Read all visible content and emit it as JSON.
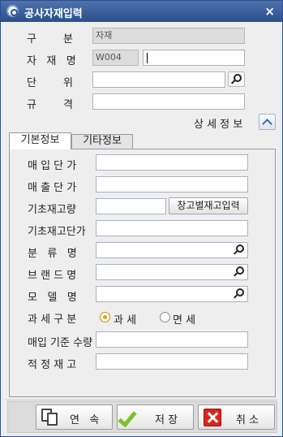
{
  "window": {
    "title": "공사자재입력",
    "close_glyph": "×"
  },
  "top_fields": {
    "category": {
      "label": "구        분",
      "value": "자재"
    },
    "code_name": {
      "label": "자   재   명",
      "code": "W004",
      "name_value": ""
    },
    "unit": {
      "label": "단        위",
      "value": ""
    },
    "spec": {
      "label": "규        격",
      "value": ""
    }
  },
  "detail_toggle": {
    "label": "상 세 정 보",
    "icon": "chevron-up-icon"
  },
  "tabs": [
    {
      "label": "기본정보",
      "active": true
    },
    {
      "label": "기타정보",
      "active": false
    }
  ],
  "basic_info": {
    "purchase_price": {
      "label": "매 입 단 가",
      "value": ""
    },
    "sale_price": {
      "label": "매 출 단 가",
      "value": ""
    },
    "base_stock_qty": {
      "label": "기초재고량",
      "value": "",
      "button": "창고별재고입력"
    },
    "base_stock_price": {
      "label": "기초재고단가",
      "value": ""
    },
    "class_name": {
      "label": "분   류   명",
      "value": ""
    },
    "brand_name": {
      "label": "브 랜 드 명",
      "value": ""
    },
    "model_name": {
      "label": "모   델   명",
      "value": ""
    },
    "tax_type": {
      "label": "과 세 구 분",
      "options": [
        {
          "label": "과 세",
          "selected": true
        },
        {
          "label": "면 세",
          "selected": false
        }
      ]
    },
    "purchase_base_qty": {
      "label": "매입 기준 수량",
      "value": ""
    },
    "safety_stock": {
      "label": "적 정 재 고",
      "value": ""
    }
  },
  "footer": {
    "continuous": "연   속",
    "save": "저 장",
    "cancel": "취 소"
  },
  "colors": {
    "titlebar": "#2a4f8c",
    "radio_selected": "#e3a215",
    "check_icon": "#7cc22c",
    "cancel_icon": "#d9261c"
  }
}
